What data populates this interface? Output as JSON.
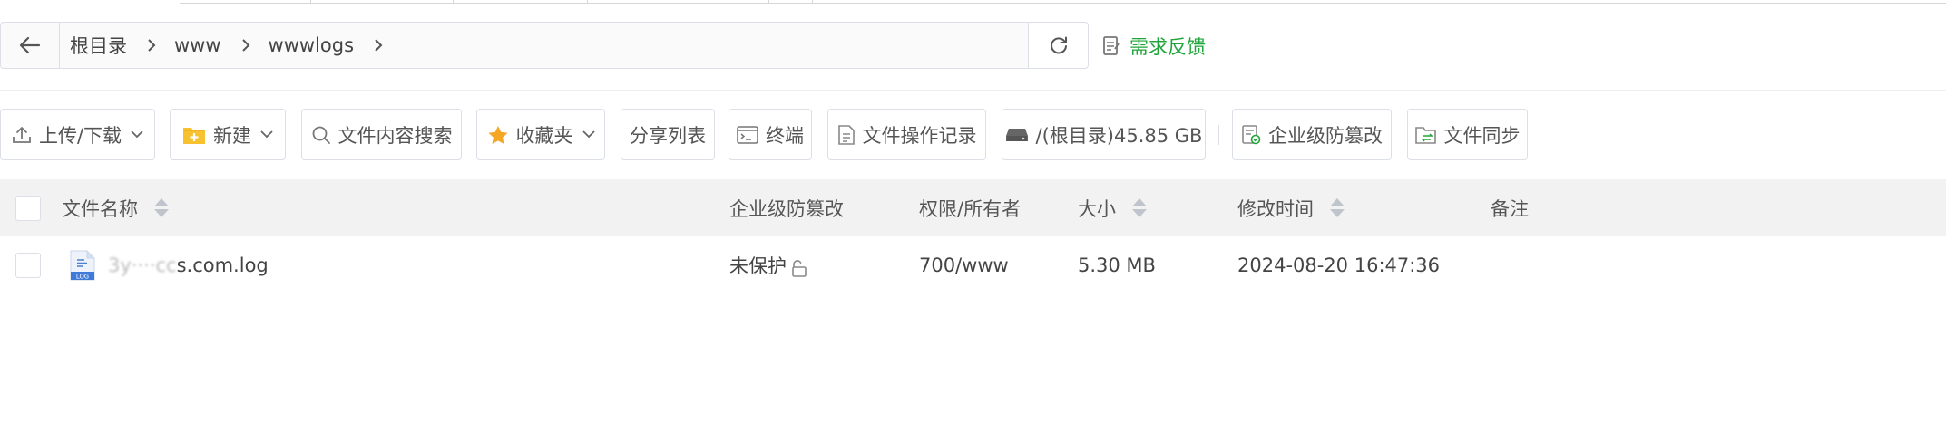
{
  "colors": {
    "accent": "#20a53a",
    "border": "#dcdfe6",
    "header_bg": "#f2f2f2",
    "text": "#333333"
  },
  "path": {
    "back_icon": "arrow-left-icon",
    "crumbs": [
      "根目录",
      "www",
      "wwwlogs"
    ],
    "separator_icon": "chevron-right-icon",
    "refresh_icon": "refresh-icon"
  },
  "feedback": {
    "label": "需求反馈",
    "icon": "feedback-note-icon"
  },
  "toolbar": {
    "upload": "上传/下载",
    "new": "新建",
    "content_search": "文件内容搜索",
    "favorites": "收藏夹",
    "share_list": "分享列表",
    "terminal": "终端",
    "op_log": "文件操作记录",
    "disk": "/(根目录)45.85 GB",
    "tamper": "企业级防篡改",
    "sync": "文件同步"
  },
  "table": {
    "columns": {
      "name": "文件名称",
      "tamper": "企业级防篡改",
      "perm": "权限/所有者",
      "size": "大小",
      "mtime": "修改时间",
      "note": "备注"
    },
    "rows": [
      {
        "icon": "log-file-icon",
        "icon_label": "LOG",
        "name_prefix": "3y",
        "name_obscured": "····cc",
        "name_suffix": "s.com.log",
        "tamper": "未保护",
        "tamper_icon": "unlock-icon",
        "perm": "700/www",
        "size": "5.30 MB",
        "mtime": "2024-08-20 16:47:36",
        "note": ""
      }
    ]
  }
}
